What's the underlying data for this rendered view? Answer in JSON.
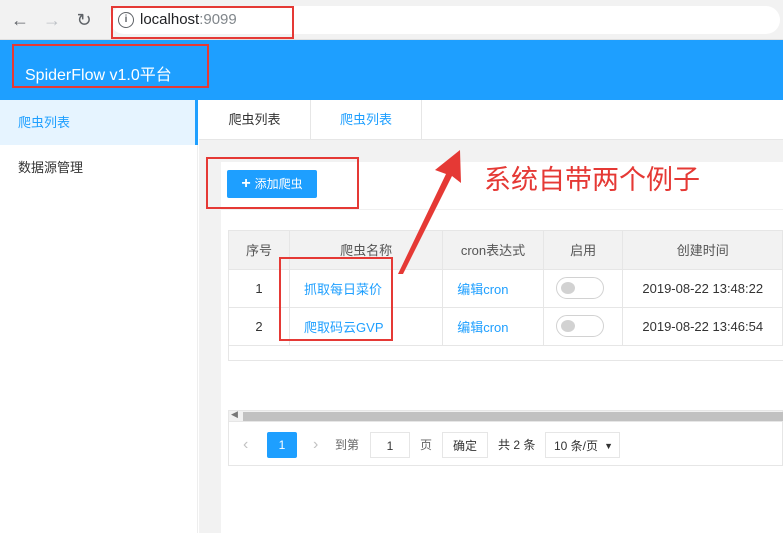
{
  "browser": {
    "host": "localhost",
    "port": ":9099"
  },
  "header": {
    "title": "SpiderFlow v1.0平台"
  },
  "sidebar": {
    "items": [
      {
        "label": "爬虫列表",
        "active": true
      },
      {
        "label": "数据源管理",
        "active": false
      }
    ]
  },
  "tabs": [
    {
      "label": "爬虫列表"
    },
    {
      "label": "爬虫列表"
    }
  ],
  "toolbar": {
    "add_label": "添加爬虫"
  },
  "table": {
    "headers": [
      "序号",
      "爬虫名称",
      "cron表达式",
      "启用",
      "创建时间"
    ],
    "rows": [
      {
        "index": "1",
        "name": "抓取每日菜价",
        "cron": "编辑cron",
        "enabled": false,
        "created": "2019-08-22 13:48:22"
      },
      {
        "index": "2",
        "name": "爬取码云GVP",
        "cron": "编辑cron",
        "enabled": false,
        "created": "2019-08-22 13:46:54"
      }
    ]
  },
  "pager": {
    "current_page": "1",
    "goto_label": "到第",
    "page_input": "1",
    "page_unit": "页",
    "confirm_label": "确定",
    "total_label": "共 2 条",
    "page_size": "10 条/页"
  },
  "annotation": {
    "text": "系统自带两个例子",
    "color": "#e53935"
  },
  "colors": {
    "primary": "#1e9fff"
  }
}
